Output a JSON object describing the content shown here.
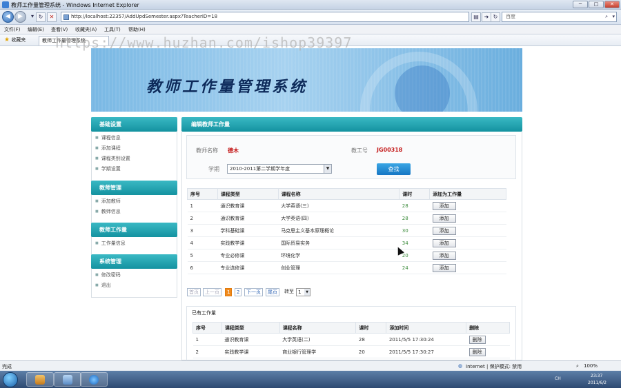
{
  "window": {
    "title": "教师工作量管理系统 - Windows Internet Explorer",
    "min": "─",
    "max": "□",
    "close": "✕"
  },
  "browser": {
    "url": "http://localhost:22357/AddUpdSemester.aspx?TeacherID=18",
    "search_text": "百度",
    "menu": [
      "文件(F)",
      "编辑(E)",
      "查看(V)",
      "收藏夹(A)",
      "工具(T)",
      "帮助(H)"
    ],
    "favorites_label": "收藏夹",
    "tab_label": "教师工作量管理系统"
  },
  "watermark": "https://www.huzhan.com/ishop39397",
  "banner": {
    "title": "教师工作量管理系统"
  },
  "sidebar": {
    "sections": [
      {
        "title": "基础设置",
        "items": [
          "课程信息",
          "添加课程",
          "课程类别设置",
          "学期设置"
        ]
      },
      {
        "title": "教师管理",
        "items": [
          "添加教师",
          "教师信息"
        ]
      },
      {
        "title": "教师工作量",
        "items": [
          "工作量信息"
        ]
      },
      {
        "title": "系统管理",
        "items": [
          "修改密码",
          "退出"
        ]
      }
    ]
  },
  "main": {
    "title": "编辑教师工作量",
    "filter": {
      "name_label": "教师名称",
      "name_value": "德木",
      "id_label": "教工号",
      "id_value": "JG00318",
      "semester_label": "学期",
      "semester_value": "2010-2011第二学期学年度",
      "find_button": "查找"
    },
    "course_table": {
      "headers": [
        "序号",
        "课程类型",
        "课程名称",
        "课时",
        "添加为工作量"
      ],
      "add_label": "添加",
      "rows": [
        [
          "1",
          "通识教育课",
          "大学英语(三)",
          "28"
        ],
        [
          "2",
          "通识教育课",
          "大学英语(四)",
          "28"
        ],
        [
          "3",
          "学科基础课",
          "马克思主义基本原理概论",
          "30"
        ],
        [
          "4",
          "实践教学课",
          "国际贸易实务",
          "34"
        ],
        [
          "5",
          "专业必修课",
          "环境化学",
          "20"
        ],
        [
          "6",
          "专业选修课",
          "创业管理",
          "24"
        ]
      ]
    },
    "pager": {
      "first": "首页",
      "prev": "上一页",
      "pages": [
        "1",
        "2"
      ],
      "next": "下一页",
      "last": "尾页",
      "goto_label": "转至",
      "goto_value": "1"
    },
    "done": {
      "title": "已有工作量",
      "headers": [
        "序号",
        "课程类型",
        "课程名称",
        "课时",
        "添加时间",
        "删除"
      ],
      "delete_label": "删除",
      "rows": [
        [
          "1",
          "通识教育课",
          "大学英语(二)",
          "28",
          "2011/5/5 17:30:24"
        ],
        [
          "2",
          "实践教学课",
          "商业银行管理学",
          "20",
          "2011/5/5 17:30:27"
        ]
      ]
    }
  },
  "status": {
    "left": "完成",
    "zone": "Internet | 保护模式: 禁用",
    "zoom": "100%"
  },
  "taskbar": {
    "time": "23:37",
    "date": "2011/6/2",
    "lang": "CH"
  }
}
